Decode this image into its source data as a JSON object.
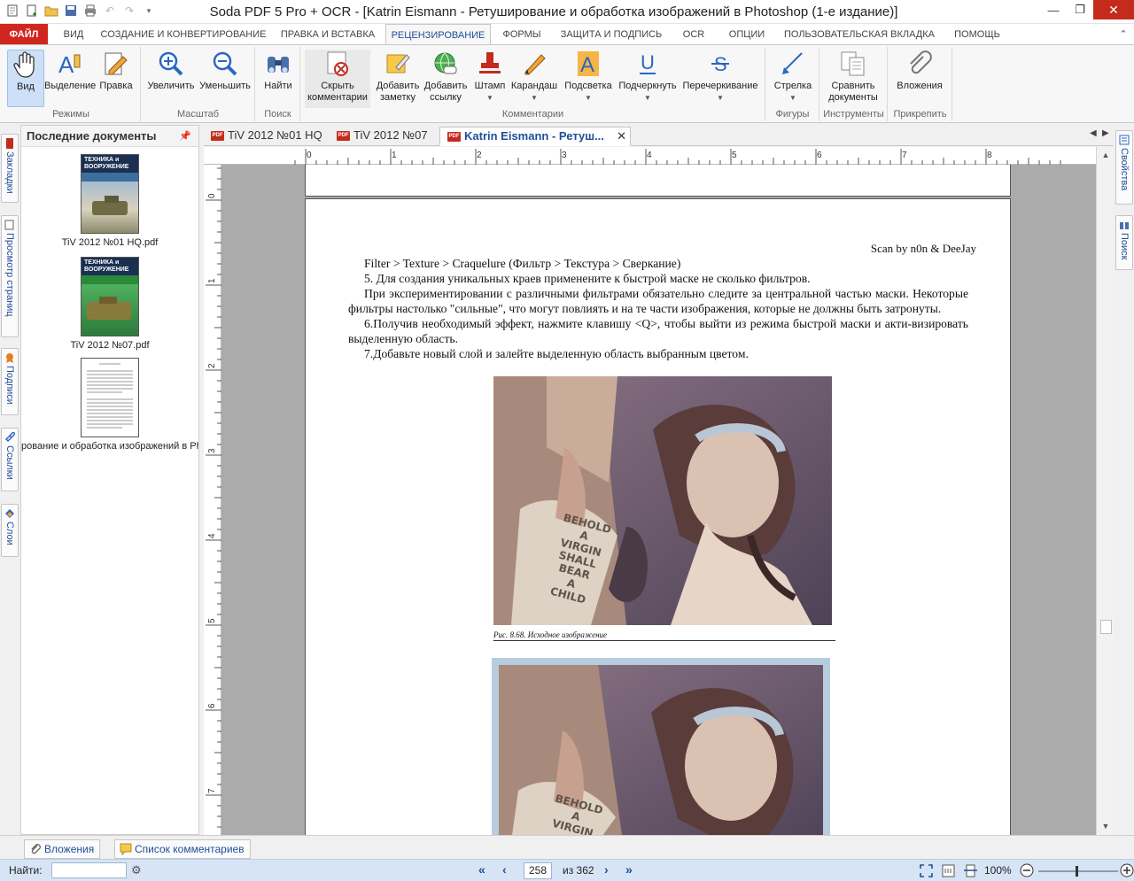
{
  "window": {
    "title": "Soda PDF 5 Pro + OCR - [Katrin Eismann - Ретуширование и обработка изображений в Photoshop (1-е издание)]"
  },
  "ribbon_tabs": [
    {
      "label": "ФАЙЛ"
    },
    {
      "label": "ВИД"
    },
    {
      "label": "СОЗДАНИЕ И КОНВЕРТИРОВАНИЕ"
    },
    {
      "label": "ПРАВКА И ВСТАВКА"
    },
    {
      "label": "РЕЦЕНЗИРОВАНИЕ"
    },
    {
      "label": "ФОРМЫ"
    },
    {
      "label": "ЗАЩИТА И ПОДПИСЬ"
    },
    {
      "label": "OCR"
    },
    {
      "label": "ОПЦИИ"
    },
    {
      "label": "ПОЛЬЗОВАТЕЛЬСКАЯ ВКЛАДКА"
    },
    {
      "label": "ПОМОЩЬ"
    }
  ],
  "ribbon": {
    "groups": {
      "modes": "Режимы",
      "zoom": "Масштаб",
      "search": "Поиск",
      "comments": "Комментарии",
      "shapes": "Фигуры",
      "tools": "Инструменты",
      "attach": "Прикрепить"
    },
    "buttons": {
      "view": "Вид",
      "select": "Выделение",
      "edit": "Правка",
      "zoom_in": "Увеличить",
      "zoom_out": "Уменьшить",
      "find": "Найти",
      "hide_comments_1": "Скрыть",
      "hide_comments_2": "комментарии",
      "add_note_1": "Добавить",
      "add_note_2": "заметку",
      "add_link_1": "Добавить",
      "add_link_2": "ссылку",
      "stamp": "Штамп",
      "pencil": "Карандаш",
      "highlight": "Подсветка",
      "underline": "Подчеркнуть",
      "strikeout": "Перечеркивание",
      "arrow": "Стрелка",
      "compare_1": "Сравнить",
      "compare_2": "документы",
      "attachments": "Вложения"
    }
  },
  "side_tabs": {
    "bookmarks": "Закладки",
    "page_view": "Просмотр страниц",
    "signatures": "Подписи",
    "links": "Ссылки",
    "layers": "Слои",
    "properties": "Свойства",
    "search": "Поиск"
  },
  "recent": {
    "title": "Последние документы",
    "items": [
      {
        "name": "TiV 2012 №01 HQ.pdf"
      },
      {
        "name": "TiV 2012 №07.pdf"
      },
      {
        "name": "рование и обработка изображений в Phot"
      }
    ],
    "magazine_title_1": "ТЕХНИКА и",
    "magazine_title_2": "ВООРУЖЕНИЕ"
  },
  "doc_tabs": [
    {
      "label": "TiV 2012 №01 HQ"
    },
    {
      "label": "TiV 2012 №07"
    },
    {
      "label": "Katrin Eismann - Ретуш..."
    }
  ],
  "ruler": {
    "h": [
      "0",
      "1",
      "2",
      "3",
      "4",
      "5",
      "6",
      "7",
      "8"
    ],
    "v": [
      "0",
      "1",
      "2",
      "3",
      "4",
      "5",
      "6",
      "7"
    ]
  },
  "page": {
    "scan_by": "Scan by n0n & DeeJay",
    "lines": [
      "Filter > Texture > Craquelure (Фильтр > Текстура > Сверкание)",
      "5.   Для   создания   уникальных   краев применените   к   быстрой   маске   не сколько фильтров.",
      "При экспериментировании с различными фильтрами обязательно следите за центральной   частью   маски. Некоторые фильтры настолько \"сильные\", что могут повлиять и на те части изображения, которые не должны быть затронуты.",
      "6.Получив необходимый эффект,  нажмите клавишу <Q>, чтобы выйти из режима быстрой маски и акти-визировать выделенную область.",
      "7.Добавьте новый слой и залейте выделенную область выбранным цветом."
    ],
    "caption": "Рис. 8.68. Исходное изображение",
    "scroll_text": [
      "BEHOLD",
      "A",
      "VIRGIN",
      "SHALL",
      "BEAR",
      "A",
      "CHILD"
    ]
  },
  "bottom_tabs": {
    "attachments": "Вложения",
    "comments_list": "Список комментариев"
  },
  "status": {
    "find_label": "Найти:",
    "find_value": "",
    "page_current": "258",
    "page_total": "из 362",
    "zoom": "100%"
  },
  "colors": {
    "accent": "#1f4e99",
    "file_tab": "#d1261d",
    "status_bar": "#d6e4f5"
  }
}
